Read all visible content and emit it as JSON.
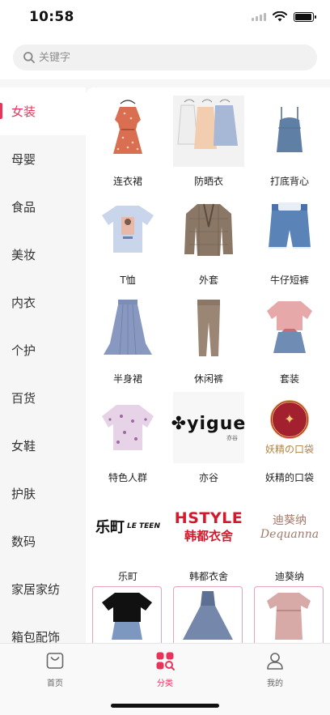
{
  "status_bar": {
    "time": "10:58",
    "battery_level": 0.95
  },
  "search": {
    "placeholder": "关键字"
  },
  "sidebar": {
    "active_index": 0,
    "items": [
      {
        "label": "女装"
      },
      {
        "label": "母婴"
      },
      {
        "label": "食品"
      },
      {
        "label": "美妆"
      },
      {
        "label": "内衣"
      },
      {
        "label": "个护"
      },
      {
        "label": "百货"
      },
      {
        "label": "女鞋"
      },
      {
        "label": "护肤"
      },
      {
        "label": "数码"
      },
      {
        "label": "家居家纺"
      },
      {
        "label": "箱包配饰"
      }
    ]
  },
  "grid": {
    "items": [
      {
        "label": "连衣裙",
        "icon": "floral-dress-image"
      },
      {
        "label": "防晒衣",
        "icon": "sun-protection-shirts-image"
      },
      {
        "label": "打底背心",
        "icon": "camisole-image"
      },
      {
        "label": "T恤",
        "icon": "printed-tshirt-image"
      },
      {
        "label": "外套",
        "icon": "plaid-blazer-image"
      },
      {
        "label": "牛仔短裤",
        "icon": "denim-shorts-image"
      },
      {
        "label": "半身裙",
        "icon": "pleated-skirt-image"
      },
      {
        "label": "休闲裤",
        "icon": "casual-trousers-image"
      },
      {
        "label": "套装",
        "icon": "two-piece-set-image"
      },
      {
        "label": "特色人群",
        "icon": "floral-blouse-image"
      },
      {
        "label": "亦谷",
        "icon": "yigue-logo",
        "logo_text": "yigue",
        "logo_subtext": "亦谷"
      },
      {
        "label": "妖精的口袋",
        "icon": "fairy-pocket-logo",
        "logo_text": "妖精の口袋"
      },
      {
        "label": "乐町",
        "icon": "leteen-logo",
        "logo_text": "乐町",
        "logo_subtext": "LE TEEN"
      },
      {
        "label": "韩都衣舍",
        "icon": "hstyle-logo",
        "logo_text": "HSTYLE",
        "logo_subtext": "韩都衣舍"
      },
      {
        "label": "迪葵纳",
        "icon": "dequanna-logo",
        "logo_text": "迪葵纳",
        "logo_subtext": "Dequanna"
      }
    ]
  },
  "promo_row": [
    {
      "icon": "black-tee-outfit-image"
    },
    {
      "icon": "tulle-gown-image"
    },
    {
      "icon": "pink-knit-dress-image"
    }
  ],
  "tabbar": {
    "items": [
      {
        "label": "首页",
        "icon": "home-bag-icon"
      },
      {
        "label": "分类",
        "icon": "category-grid-icon"
      },
      {
        "label": "我的",
        "icon": "user-icon"
      }
    ],
    "active_index": 1,
    "accent": "#e8345a"
  }
}
